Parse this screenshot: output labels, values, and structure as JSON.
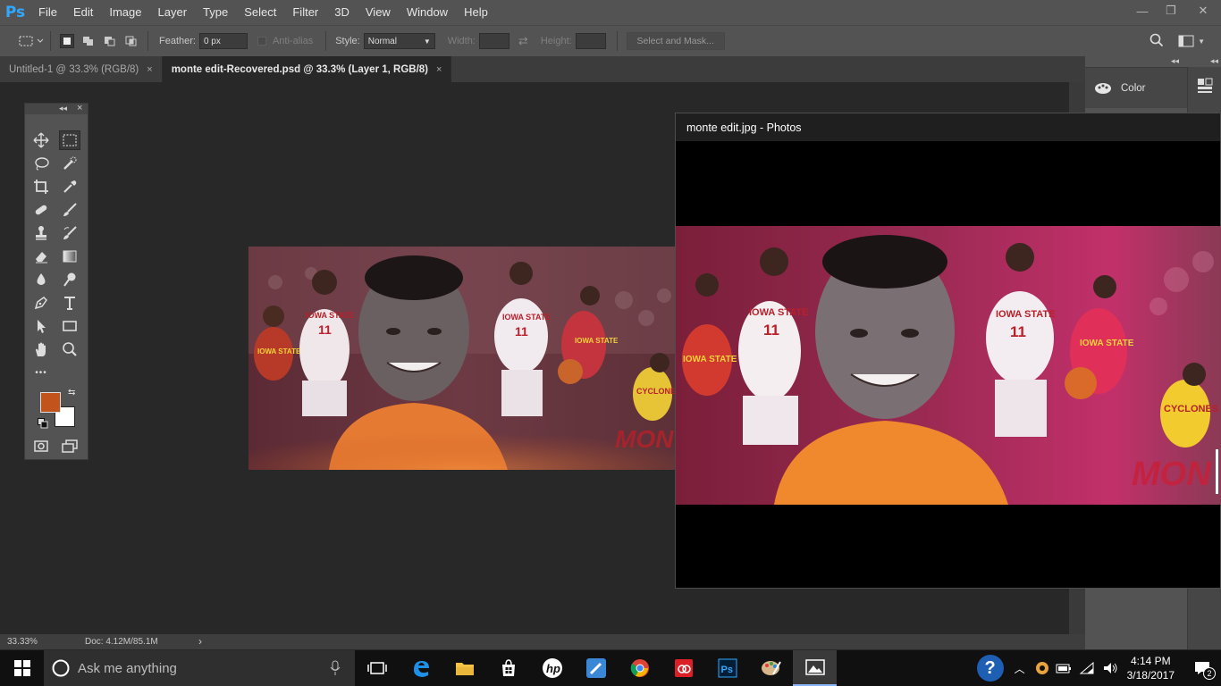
{
  "app": {
    "logo": "Ps"
  },
  "menu": [
    "File",
    "Edit",
    "Image",
    "Layer",
    "Type",
    "Select",
    "Filter",
    "3D",
    "View",
    "Window",
    "Help"
  ],
  "window_controls": {
    "minimize": "—",
    "restore": "❐",
    "close": "✕"
  },
  "options": {
    "feather_label": "Feather:",
    "feather_value": "0 px",
    "antialias_label": "Anti-alias",
    "style_label": "Style:",
    "style_value": "Normal",
    "width_label": "Width:",
    "height_label": "Height:",
    "select_mask_label": "Select and Mask..."
  },
  "tabs": [
    {
      "label": "Untitled-1 @ 33.3% (RGB/8)",
      "close": "×"
    },
    {
      "label": "monte edit-Recovered.psd @ 33.3% (Layer 1, RGB/8)",
      "close": "×"
    }
  ],
  "toolbox": {
    "collapse": "◂◂",
    "close": "×",
    "more": "•••",
    "foreground_color": "#c2531d",
    "background_color": "#ffffff"
  },
  "right_panel": {
    "color_label": "Color",
    "collapse": "◂◂"
  },
  "status": {
    "zoom": "33.33%",
    "doc": "Doc: 4.12M/85.1M",
    "arrow": "›"
  },
  "photos": {
    "title": "monte edit.jpg - Photos"
  },
  "taskbar": {
    "search_placeholder": "Ask me anything",
    "time": "4:14 PM",
    "date": "3/18/2017",
    "notifications": "2"
  },
  "artwork": {
    "jersey_text": "IOWA STATE",
    "jersey_number": "11",
    "alt_jersey_text": "CYCLONES",
    "side_text": "MON"
  }
}
